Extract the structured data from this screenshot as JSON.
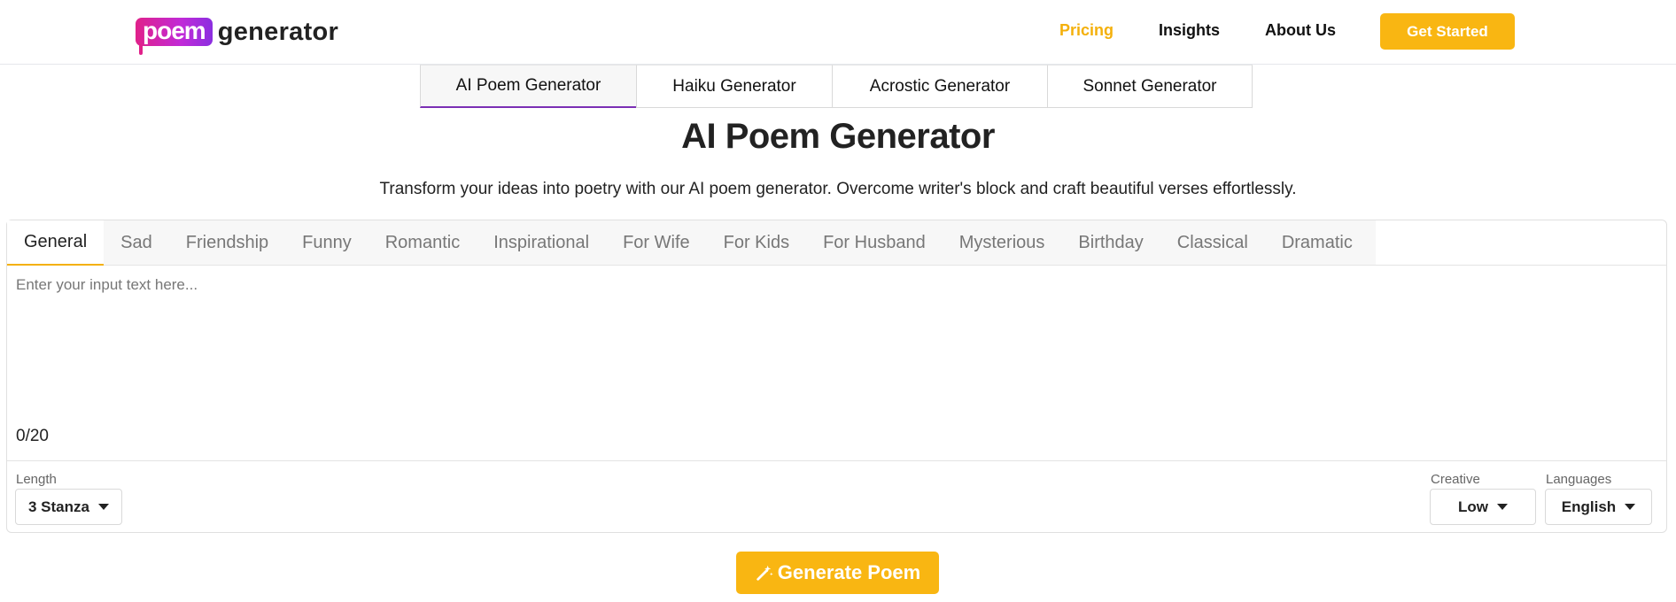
{
  "header": {
    "logo_badge": "poem",
    "logo_word": "generator",
    "nav": {
      "pricing": "Pricing",
      "insights": "Insights",
      "about": "About Us"
    },
    "cta": "Get Started"
  },
  "generator_tabs": [
    "AI Poem Generator",
    "Haiku Generator",
    "Acrostic Generator",
    "Sonnet Generator"
  ],
  "active_generator_tab": "AI Poem Generator",
  "page_title": "AI Poem Generator",
  "subtitle": "Transform your ideas into poetry with our AI poem generator. Overcome writer's block and craft beautiful verses effortlessly.",
  "style_tabs": [
    "General",
    "Sad",
    "Friendship",
    "Funny",
    "Romantic",
    "Inspirational",
    "For Wife",
    "For Kids",
    "For Husband",
    "Mysterious",
    "Birthday",
    "Classical",
    "Dramatic"
  ],
  "active_style_tab": "General",
  "input": {
    "placeholder": "Enter your input text here...",
    "value": "",
    "counter": "0/20"
  },
  "options": {
    "length_label": "Length",
    "length_value": "3 Stanza",
    "creative_label": "Creative",
    "creative_value": "Low",
    "languages_label": "Languages",
    "languages_value": "English"
  },
  "generate_button": "Generate Poem",
  "colors": {
    "accent": "#f9b612",
    "pricing": "#f4b00b",
    "active_tab_underline": "#7b2fb5",
    "logo_gradient_start": "#e0218a",
    "logo_gradient_end": "#8b2fe0"
  }
}
